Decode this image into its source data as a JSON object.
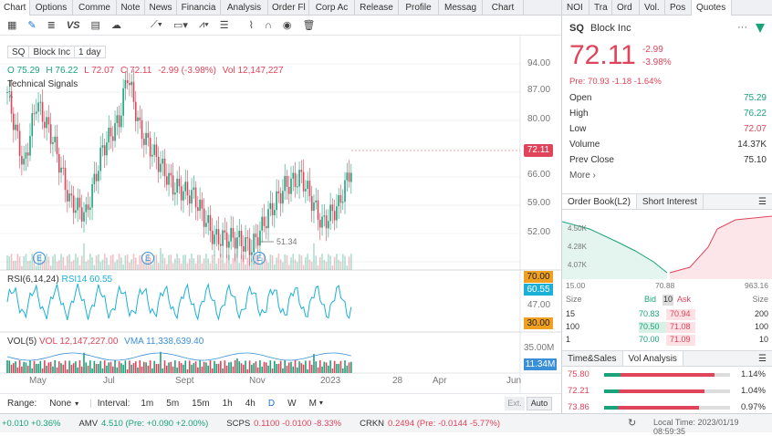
{
  "left_tabs": [
    "Chart",
    "Options",
    "Comme",
    "Note",
    "News",
    "Financia",
    "Analysis",
    "Order Fl",
    "Corp Ac",
    "Release",
    "Profile",
    "Messag",
    "Chart"
  ],
  "toolbar_text": {
    "vs": "VS"
  },
  "symbol": {
    "ticker": "SQ",
    "name": "Block Inc",
    "interval": "1 day"
  },
  "ohlc": {
    "o_label": "O",
    "o": "75.29",
    "h_label": "H",
    "h": "76.22",
    "l_label": "L",
    "l": "72.07",
    "c_label": "C",
    "c": "72.11",
    "chg": "-2.99 (-3.98%)",
    "vol_label": "Vol",
    "vol": "12,147,227"
  },
  "tech_signals": "Technical Signals",
  "price_axis": [
    "94.00",
    "87.00",
    "80.00",
    "73.00",
    "66.00",
    "59.00",
    "52.00"
  ],
  "price_tag": "72.11",
  "low_annotation": "51.34",
  "events": [
    "E",
    "E",
    "E"
  ],
  "rsi": {
    "label": "RSI(6,14,24)",
    "value_label": "RSI14 60.55",
    "axis_top": "70.00",
    "current": "60.55",
    "mid": "47.00",
    "axis_low": "30.00"
  },
  "vol_panel": {
    "label": "VOL(5)",
    "vol": "VOL 12,147,227.00",
    "vma": "VMA 11,338,639.40",
    "axis": "35.00M",
    "current": "11.34M"
  },
  "x_axis": [
    "May",
    "Jul",
    "Sept",
    "Nov",
    "2023",
    "28",
    "Apr",
    "Jun"
  ],
  "range": {
    "label": "Range:",
    "value": "None",
    "interval_label": "Interval:",
    "intervals": [
      "1m",
      "5m",
      "15m",
      "1h",
      "4h",
      "D",
      "W",
      "M"
    ],
    "active": "D",
    "ext": "Ext.",
    "auto": "Auto"
  },
  "right_tabs": [
    "NOI",
    "Tra",
    "Ord",
    "Vol.",
    "Pos",
    "Quotes"
  ],
  "quote": {
    "ticker": "SQ",
    "name": "Block Inc",
    "price": "72.11",
    "chg": "-2.99",
    "chg_pct": "-3.98%",
    "pre": "Pre: 70.93 -1.18 -1.64%"
  },
  "quote_rows": [
    {
      "k": "Open",
      "v": "75.29"
    },
    {
      "k": "High",
      "v": "76.22"
    },
    {
      "k": "Low",
      "v": "72.07"
    },
    {
      "k": "Volume",
      "v": "14.37K"
    },
    {
      "k": "Prev Close",
      "v": "75.10"
    },
    {
      "k": "More ›",
      "v": ""
    }
  ],
  "orderbook": {
    "tab1": "Order Book(L2)",
    "tab2": "Short Interest",
    "y": [
      "4.50K",
      "4.28K",
      "4.07K"
    ],
    "x": [
      "15.00",
      "70.88",
      "963.16"
    ],
    "headers": {
      "size": "Size",
      "bid": "Bid",
      "mid": "10",
      "ask": "Ask",
      "size2": "Size"
    },
    "rows": [
      {
        "s": "15",
        "b": "70.83",
        "a": "70.94",
        "s2": "200"
      },
      {
        "s": "100",
        "b": "70.50",
        "a": "71.08",
        "s2": "100"
      },
      {
        "s": "1",
        "b": "70.00",
        "a": "71.09",
        "s2": "10"
      }
    ]
  },
  "volanalysis": {
    "tab1": "Time&Sales",
    "tab2": "Vol Analysis",
    "rows": [
      {
        "p": "75.80",
        "pct": "1.14%",
        "fill": 0.88
      },
      {
        "p": "72.21",
        "pct": "1.04%",
        "fill": 0.8
      },
      {
        "p": "73.86",
        "pct": "0.97%",
        "fill": 0.75
      }
    ]
  },
  "bottom": {
    "t1": "+0.010 +0.36%",
    "t2n": "AMV",
    "t2": "4.510 (Pre: +0.090 +2.00%)",
    "t3n": "SCPS",
    "t3": "0.1100 -0.0100 -8.33%",
    "t4n": "CRKN",
    "t4": "0.2494 (Pre: -0.0144 -5.77%)",
    "time": "Local Time: 2023/01/19 08:59:35"
  }
}
